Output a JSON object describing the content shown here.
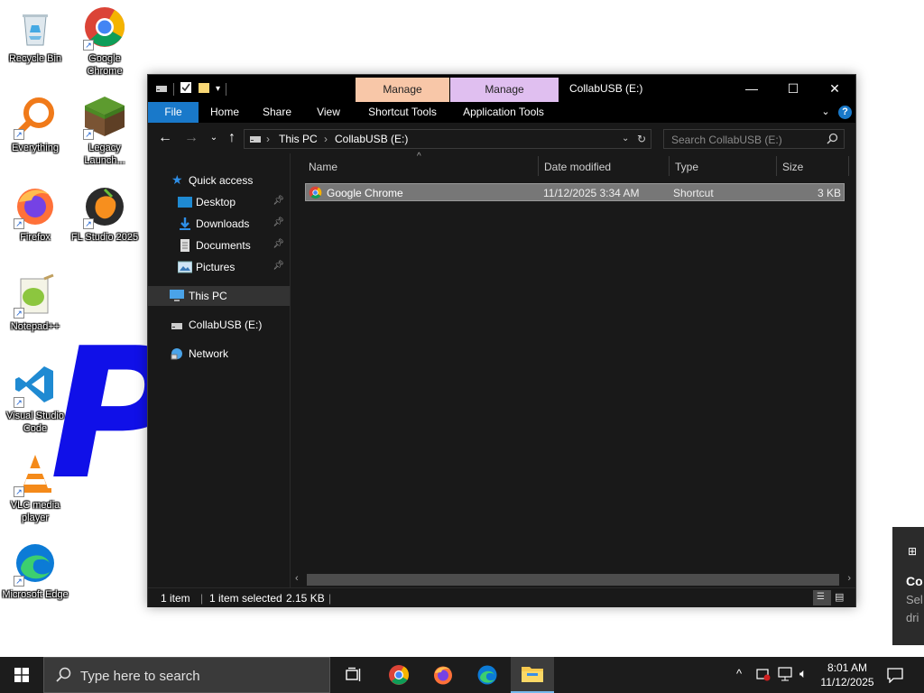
{
  "desktop": {
    "icons": [
      {
        "label": "Recycle Bin",
        "icon": "recycle-bin-icon"
      },
      {
        "label": "Google Chrome",
        "icon": "chrome-icon"
      },
      {
        "label": "Everything",
        "icon": "everything-search-icon"
      },
      {
        "label": "Legacy Launch...",
        "icon": "minecraft-grass-block-icon"
      },
      {
        "label": "Firefox",
        "icon": "firefox-icon"
      },
      {
        "label": "FL Studio 2025",
        "icon": "fl-studio-icon"
      },
      {
        "label": "Notepad++",
        "icon": "notepad-plus-plus-icon"
      },
      {
        "label": "Visual Studio Code",
        "icon": "vscode-icon"
      },
      {
        "label": "VLC media player",
        "icon": "vlc-icon"
      },
      {
        "label": "Microsoft Edge",
        "icon": "edge-icon"
      }
    ]
  },
  "explorer": {
    "title": "CollabUSB (E:)",
    "context_tabs": [
      {
        "label": "Manage",
        "group": "Shortcut Tools",
        "color": "#f8c7a8"
      },
      {
        "label": "Manage",
        "group": "Application Tools",
        "color": "#e0bff0"
      }
    ],
    "ribbon_tabs": [
      "File",
      "Home",
      "Share",
      "View",
      "Shortcut Tools",
      "Application Tools"
    ],
    "breadcrumb": [
      "This PC",
      "CollabUSB (E:)"
    ],
    "search_placeholder": "Search CollabUSB (E:)",
    "nav": {
      "quick_access": "Quick access",
      "pinned": [
        "Desktop",
        "Downloads",
        "Documents",
        "Pictures"
      ],
      "this_pc": "This PC",
      "drive": "CollabUSB (E:)",
      "network": "Network"
    },
    "columns": [
      "Name",
      "Date modified",
      "Type",
      "Size"
    ],
    "files": [
      {
        "name": "Google Chrome",
        "date": "11/12/2025 3:34 AM",
        "type": "Shortcut",
        "size": "3 KB"
      }
    ],
    "status": {
      "count": "1 item",
      "selected": "1 item selected",
      "size": "2.15 KB"
    }
  },
  "notification_peek": {
    "line1": "Co",
    "line2": "Sel",
    "line3": "dri"
  },
  "taskbar": {
    "search_placeholder": "Type here to search",
    "apps": [
      "task-view",
      "chrome",
      "firefox",
      "edge",
      "file-explorer"
    ],
    "time": "8:01 AM",
    "date": "11/12/2025"
  },
  "colors": {
    "accent": "#1979ca",
    "window_bg": "#191919",
    "taskbar_bg": "#1c1c1c"
  }
}
